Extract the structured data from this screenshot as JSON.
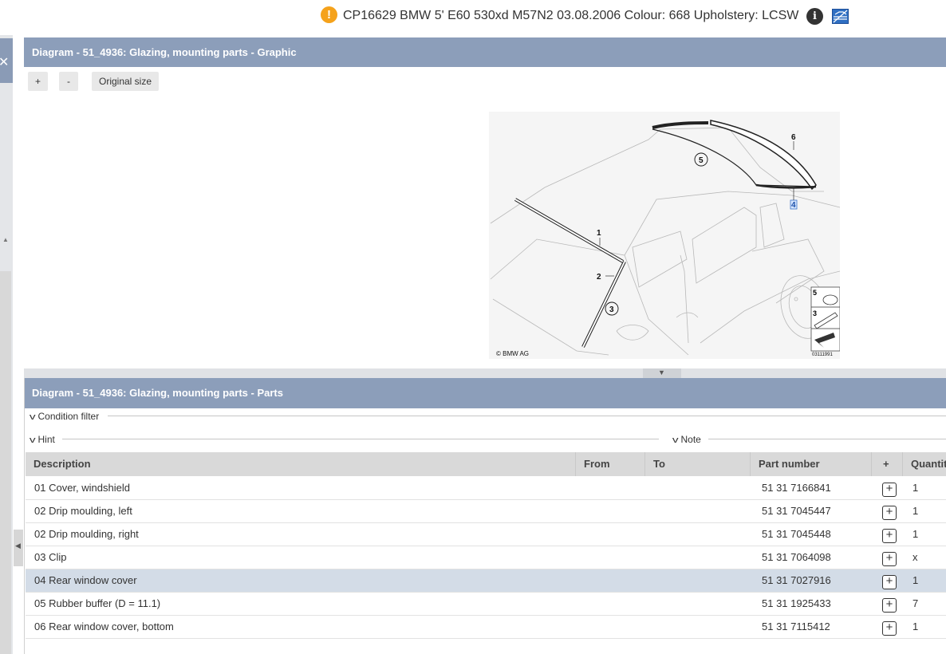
{
  "header": {
    "warning_icon": "exclamation-icon",
    "vehicle": "CP16629 BMW 5' E60 530xd M57N2 03.08.2006 Colour: 668 Upholstery: LCSW",
    "info_icon": "info-icon"
  },
  "graphic": {
    "title": "Diagram - 51_4936: Glazing, mounting parts - Graphic",
    "zoom_in": "+",
    "zoom_out": "-",
    "original_size": "Original size",
    "callouts": [
      "1",
      "2",
      "3",
      "4",
      "5",
      "6"
    ],
    "legend": [
      "5",
      "3"
    ],
    "copyright": "© BMW AG",
    "image_number": "03111991"
  },
  "parts": {
    "title": "Diagram - 51_4936: Glazing, mounting parts - Parts",
    "condition_filter": "Condition filter",
    "hint": "Hint",
    "note": "Note",
    "columns": {
      "description": "Description",
      "from": "From",
      "to": "To",
      "part_number": "Part number",
      "add": "+",
      "quantity": "Quantit"
    },
    "rows": [
      {
        "description": "01 Cover, windshield",
        "part_number": "51 31 7166841",
        "quantity": "1"
      },
      {
        "description": "02 Drip moulding, left",
        "part_number": "51 31 7045447",
        "quantity": "1"
      },
      {
        "description": "02 Drip moulding, right",
        "part_number": "51 31 7045448",
        "quantity": "1"
      },
      {
        "description": "03 Clip",
        "part_number": "51 31 7064098",
        "quantity": "x"
      },
      {
        "description": "04 Rear window cover",
        "part_number": "51 31 7027916",
        "quantity": "1"
      },
      {
        "description": "05 Rubber buffer (D = 11.1)",
        "part_number": "51 31 1925433",
        "quantity": "7"
      },
      {
        "description": "06 Rear window cover, bottom",
        "part_number": "51 31 7115412",
        "quantity": "1"
      }
    ],
    "selected_row": 4
  },
  "colors": {
    "panel_header": "#8c9eba",
    "selected_row": "#d3dce7",
    "warning": "#f5a21b"
  }
}
